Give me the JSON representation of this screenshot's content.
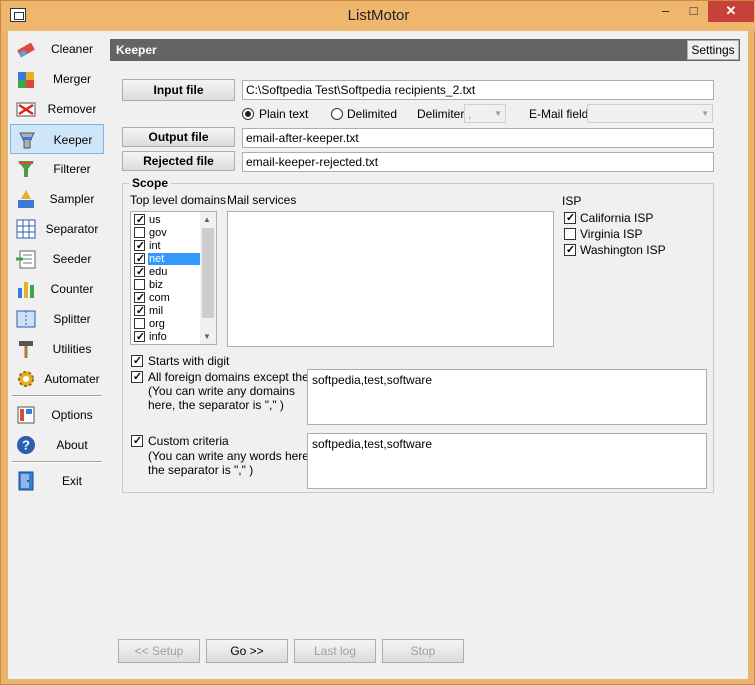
{
  "window": {
    "title": "ListMotor",
    "min": "–",
    "max": "□",
    "close": "✕"
  },
  "sidebar": {
    "items": [
      {
        "label": "Cleaner",
        "icon": "eraser-icon"
      },
      {
        "label": "Merger",
        "icon": "puzzle-icon"
      },
      {
        "label": "Remover",
        "icon": "remover-icon"
      },
      {
        "label": "Keeper",
        "icon": "keeper-icon",
        "active": true
      },
      {
        "label": "Filterer",
        "icon": "funnel-icon"
      },
      {
        "label": "Sampler",
        "icon": "sampler-icon"
      },
      {
        "label": "Separator",
        "icon": "grid-icon"
      },
      {
        "label": "Seeder",
        "icon": "seeder-icon"
      },
      {
        "label": "Counter",
        "icon": "counter-icon"
      },
      {
        "label": "Splitter",
        "icon": "splitter-icon"
      },
      {
        "label": "Utilities",
        "icon": "hammer-icon"
      },
      {
        "label": "Automater",
        "icon": "gears-icon"
      }
    ],
    "bottom": [
      {
        "label": "Options",
        "icon": "options-icon"
      },
      {
        "label": "About",
        "icon": "help-icon"
      },
      {
        "label": "Exit",
        "icon": "door-icon"
      }
    ]
  },
  "header": {
    "title": "Keeper",
    "settings": "Settings"
  },
  "files": {
    "input_label": "Input file",
    "input_value": "C:\\Softpedia Test\\Softpedia recipients_2.txt",
    "output_label": "Output file",
    "output_value": "email-after-keeper.txt",
    "rejected_label": "Rejected file",
    "rejected_value": "email-keeper-rejected.txt"
  },
  "format": {
    "plain_text": "Plain text",
    "delimited": "Delimited",
    "delimiter_label": "Delimiter",
    "delimiter_value": ",",
    "email_field_label": "E-Mail field",
    "email_field_value": ""
  },
  "scope": {
    "title": "Scope",
    "tld_label": "Top level domains",
    "tlds": [
      {
        "name": "us",
        "checked": true
      },
      {
        "name": "gov",
        "checked": false
      },
      {
        "name": "int",
        "checked": true
      },
      {
        "name": "net",
        "checked": true,
        "selected": true
      },
      {
        "name": "edu",
        "checked": true
      },
      {
        "name": "biz",
        "checked": false
      },
      {
        "name": "com",
        "checked": true
      },
      {
        "name": "mil",
        "checked": true
      },
      {
        "name": "org",
        "checked": false
      },
      {
        "name": "info",
        "checked": true
      }
    ],
    "mail_label": "Mail services",
    "isp_label": "ISP",
    "isps": [
      {
        "name": "California ISP",
        "checked": true
      },
      {
        "name": "Virginia ISP",
        "checked": false
      },
      {
        "name": "Washington ISP",
        "checked": true
      }
    ],
    "starts_with_digit": "Starts with digit",
    "foreign_line1": "All foreign domains except these",
    "foreign_line2": "(You can write any domains",
    "foreign_line3": "here, the separator is \",\" )",
    "foreign_value": "softpedia,test,software",
    "custom_line1": "Custom criteria",
    "custom_line2": "(You can write any words here,",
    "custom_line3": "the separator is \",\" )",
    "custom_value": "softpedia,test,software"
  },
  "actions": {
    "setup": "<< Setup",
    "go": "Go >>",
    "last_log": "Last log",
    "stop": "Stop"
  }
}
